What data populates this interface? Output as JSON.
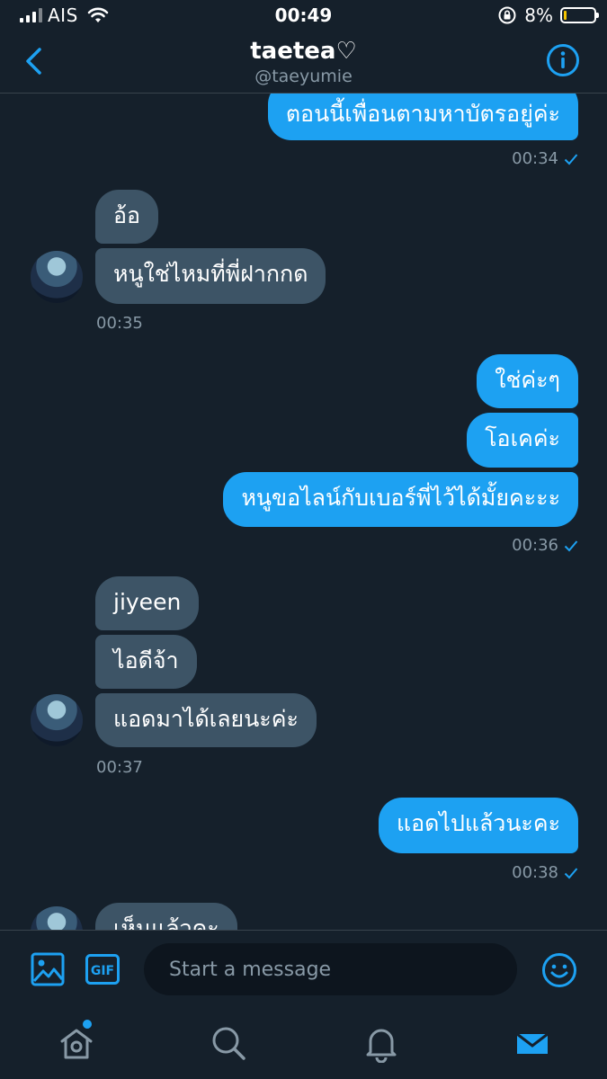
{
  "status_bar": {
    "carrier": "AIS",
    "time": "00:49",
    "battery_percent": "8%",
    "battery_level": 0.08,
    "battery_color": "#f5c400"
  },
  "header": {
    "title": "taetea♡",
    "handle": "@taeyumie",
    "back_icon": "chevron-left-icon",
    "info_icon": "info-circle-icon"
  },
  "colors": {
    "background": "#15202b",
    "accent": "#1da1f2",
    "incoming_bubble": "#3d5466",
    "secondary_text": "#8899a6"
  },
  "messages": [
    {
      "dir": "out",
      "text": "ตอนนี้เพื่อนตามหาบัตรอยู่ค่ะ"
    },
    {
      "time": "00:34",
      "dir": "out"
    },
    {
      "dir": "in",
      "text": "อ้อ"
    },
    {
      "dir": "in",
      "text": "หนูใช่ไหมที่พี่ฝากกด"
    },
    {
      "time": "00:35",
      "dir": "in"
    },
    {
      "dir": "out",
      "text": "ใช่ค่ะๆ"
    },
    {
      "dir": "out",
      "text": "โอเคค่ะ"
    },
    {
      "dir": "out",
      "text": "หนูขอไลน์กับเบอร์พี่ไว้ได้มั้ยคะะะ"
    },
    {
      "time": "00:36",
      "dir": "out"
    },
    {
      "dir": "in",
      "text": "jiyeen"
    },
    {
      "dir": "in",
      "text": "ไอดีจ้า"
    },
    {
      "dir": "in",
      "text": "แอดมาได้เลยนะค่ะ"
    },
    {
      "time": "00:37",
      "dir": "in"
    },
    {
      "dir": "out",
      "text": "แอดไปแล้วนะคะ"
    },
    {
      "time": "00:38",
      "dir": "out"
    },
    {
      "dir": "in",
      "text": "เห็นแล้วคะ"
    }
  ],
  "composer": {
    "placeholder": "Start a message",
    "media_icon": "image-icon",
    "gif_label": "GIF",
    "emoji_icon": "emoji-icon"
  },
  "tab_bar": {
    "items": [
      "home-icon",
      "search-icon",
      "bell-icon",
      "mail-icon"
    ],
    "active": "mail-icon"
  }
}
